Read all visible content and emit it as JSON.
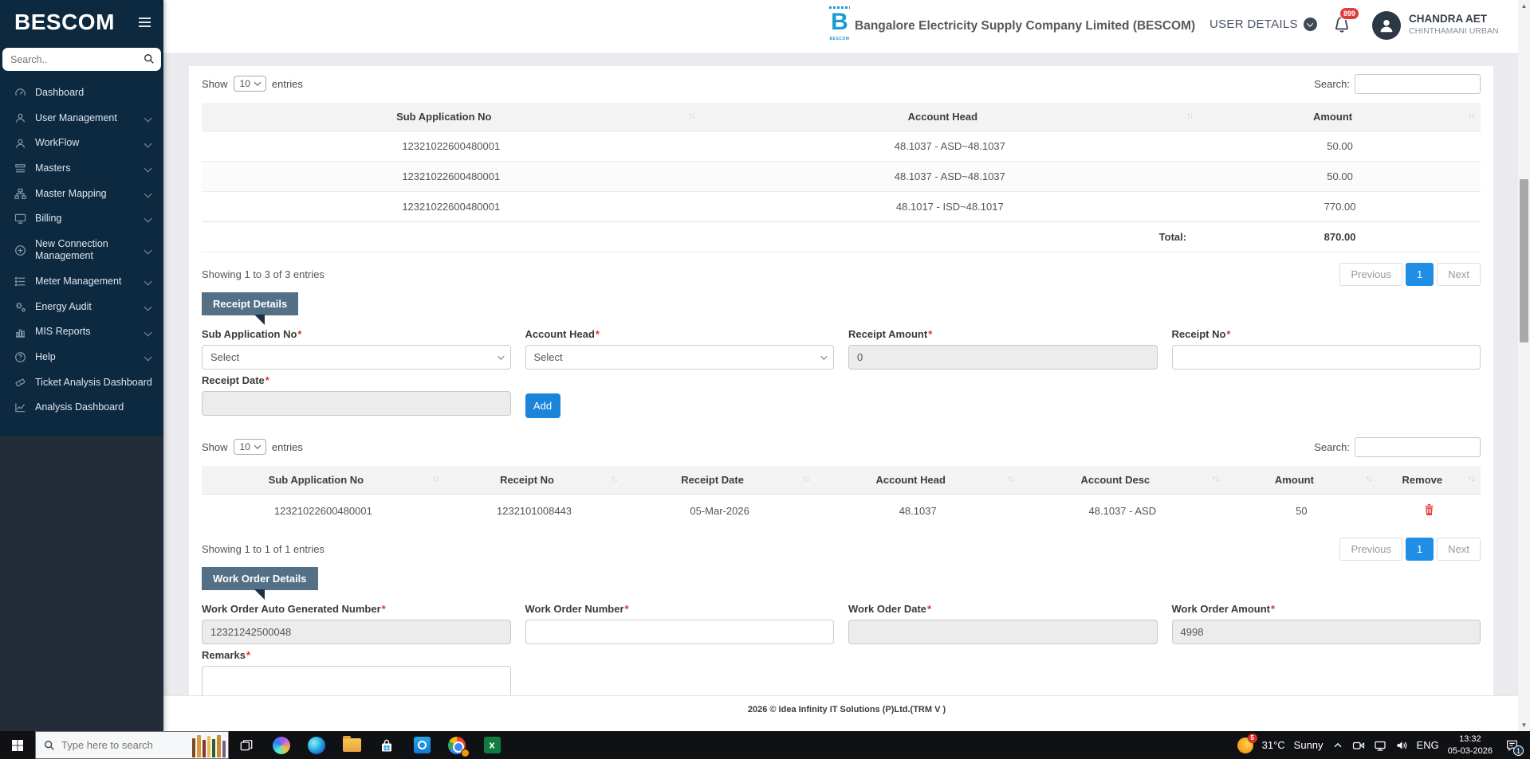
{
  "ui": {
    "required_marker": "*"
  },
  "sidebar": {
    "brand": "BESCOM",
    "search_placeholder": "Search..",
    "items": [
      {
        "label": "Dashboard"
      },
      {
        "label": "User Management"
      },
      {
        "label": "WorkFlow"
      },
      {
        "label": "Masters"
      },
      {
        "label": "Master Mapping"
      },
      {
        "label": "Billing"
      },
      {
        "label": "New Connection Management"
      },
      {
        "label": "Meter Management"
      },
      {
        "label": "Energy Audit"
      },
      {
        "label": "MIS Reports"
      },
      {
        "label": "Help"
      },
      {
        "label": "Ticket Analysis Dashboard"
      },
      {
        "label": "Analysis Dashboard"
      }
    ]
  },
  "header": {
    "company": "Bangalore Electricity Supply Company Limited (BESCOM)",
    "logo_caption": "BESCOM",
    "user_details_label": "USER DETAILS",
    "notification_count": "899",
    "user_name": "CHANDRA AET",
    "user_location": "CHINTHAMANI URBAN"
  },
  "asd_table": {
    "show_label": "Show",
    "page_size": "10",
    "entries_label": "entries",
    "search_label": "Search:",
    "columns": [
      "Sub Application No",
      "Account Head",
      "Amount"
    ],
    "rows": [
      [
        "12321022600480001",
        "48.1037 - ASD~48.1037",
        "50.00"
      ],
      [
        "12321022600480001",
        "48.1037 - ASD~48.1037",
        "50.00"
      ],
      [
        "12321022600480001",
        "48.1017 - ISD~48.1017",
        "770.00"
      ]
    ],
    "total_label": "Total:",
    "total_value": "870.00",
    "info": "Showing 1 to 3 of 3 entries",
    "prev_label": "Previous",
    "page": "1",
    "next_label": "Next"
  },
  "receipt_form": {
    "title": "Receipt Details",
    "sub_application_label": "Sub Application No",
    "sub_application_value": "Select",
    "account_head_label": "Account Head",
    "account_head_value": "Select",
    "receipt_amount_label": "Receipt Amount",
    "receipt_amount_value": "0",
    "receipt_no_label": "Receipt No",
    "receipt_date_label": "Receipt Date",
    "add_button": "Add"
  },
  "receipt_table": {
    "show_label": "Show",
    "page_size": "10",
    "entries_label": "entries",
    "search_label": "Search:",
    "columns": [
      "Sub Application No",
      "Receipt No",
      "Receipt Date",
      "Account Head",
      "Account Desc",
      "Amount",
      "Remove"
    ],
    "row": [
      "12321022600480001",
      "1232101008443",
      "05-Mar-2026",
      "48.1037",
      "48.1037 - ASD",
      "50"
    ],
    "info": "Showing 1 to 1 of 1 entries",
    "prev_label": "Previous",
    "page": "1",
    "next_label": "Next"
  },
  "work_order_form": {
    "title": "Work Order Details",
    "auto_number_label": "Work Order Auto Generated Number",
    "auto_number_value": "12321242500048",
    "number_label": "Work Order Number",
    "date_label": "Work Oder Date",
    "amount_label": "Work Order Amount",
    "amount_value": "4998",
    "remarks_label": "Remarks"
  },
  "footer": {
    "text": "2026 © Idea Infinity IT Solutions (P)Ltd.(TRM V )"
  },
  "taskbar": {
    "search_placeholder": "Type here to search",
    "weather_badge": "5",
    "weather_temp": "31°C",
    "weather_desc": "Sunny",
    "language": "ENG",
    "time": "13:32",
    "date": "05-03-2026",
    "notification_badge": "1"
  },
  "colors": {
    "sidebar_bg": "#0d2940",
    "section_badge_bg": "#547086",
    "accent_blue": "#1c84d9",
    "pagination_active": "#1e8fe4",
    "danger_red": "#e23b3b"
  }
}
